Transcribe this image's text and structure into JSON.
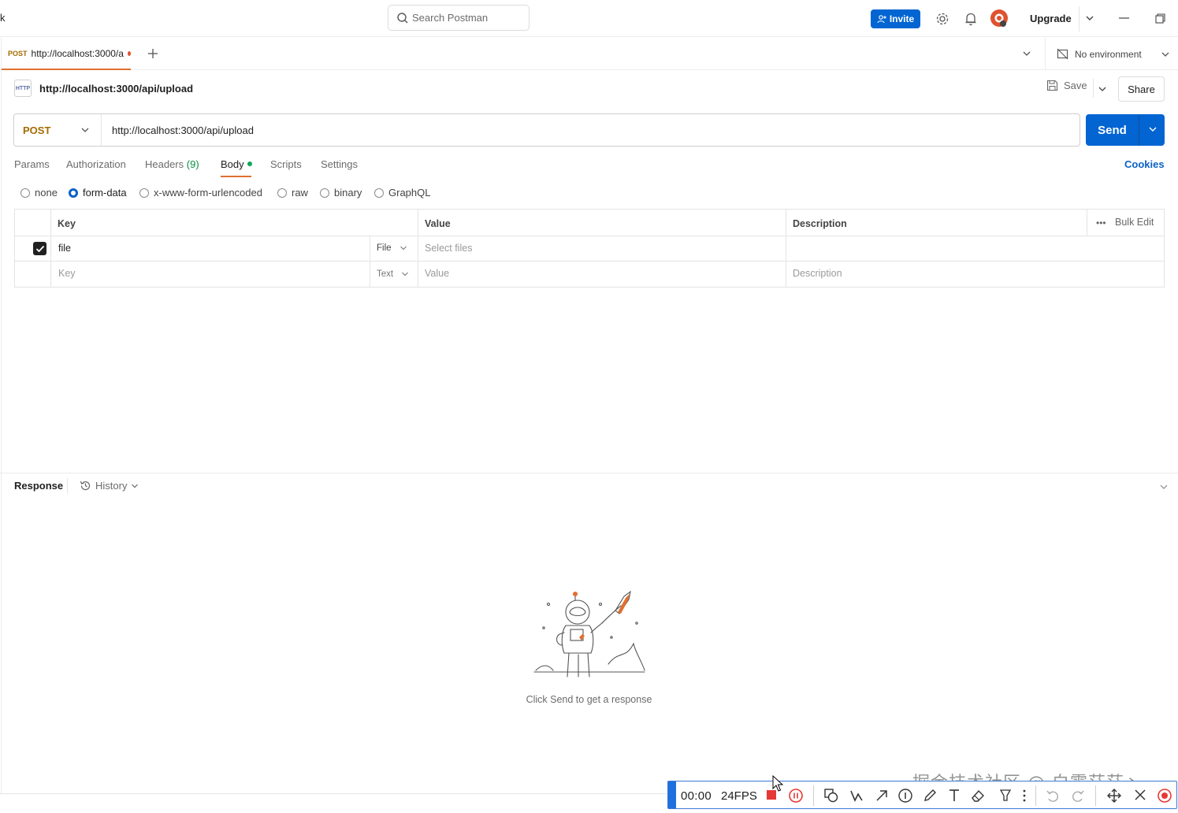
{
  "topbar": {
    "partial_left_text": "k",
    "search_placeholder": "Search Postman",
    "invite_label": "Invite",
    "upgrade_label": "Upgrade"
  },
  "tabs": {
    "open_tab": {
      "method": "POST",
      "label": "http://localhost:3000/a"
    },
    "environment_label": "No environment"
  },
  "request": {
    "name": "http://localhost:3000/api/upload",
    "http_badge": "HTTP",
    "save_label": "Save",
    "share_label": "Share",
    "method": "POST",
    "url": "http://localhost:3000/api/upload",
    "send_label": "Send",
    "tabs": [
      {
        "label": "Params"
      },
      {
        "label": "Authorization"
      },
      {
        "label": "Headers",
        "count": "(9)"
      },
      {
        "label": "Body"
      },
      {
        "label": "Scripts"
      },
      {
        "label": "Settings"
      }
    ],
    "active_tab": "Body",
    "cookies_label": "Cookies",
    "body_types": [
      "none",
      "form-data",
      "x-www-form-urlencoded",
      "raw",
      "binary",
      "GraphQL"
    ],
    "selected_body_type": "form-data"
  },
  "form_table": {
    "headers": {
      "key": "Key",
      "value": "Value",
      "description": "Description",
      "bulk_edit": "Bulk Edit"
    },
    "rows": [
      {
        "checked": true,
        "key": "file",
        "type": "File",
        "value_placeholder": "Select files",
        "description": ""
      }
    ],
    "new_row": {
      "key_placeholder": "Key",
      "type": "Text",
      "value_placeholder": "Value",
      "description_placeholder": "Description"
    }
  },
  "response": {
    "title": "Response",
    "history_label": "History",
    "empty_message": "Click Send to get a response"
  },
  "recorder": {
    "time": "00:00",
    "fps": "24FPS"
  },
  "watermark": "掘金技术社区 @ 白雾茫茫丶",
  "colors": {
    "accent_blue": "#0265d2",
    "method_post": "#a46b00",
    "tab_underline": "#e0702f",
    "unsaved_dot": "#e0522f",
    "body_dot": "#10a659"
  }
}
